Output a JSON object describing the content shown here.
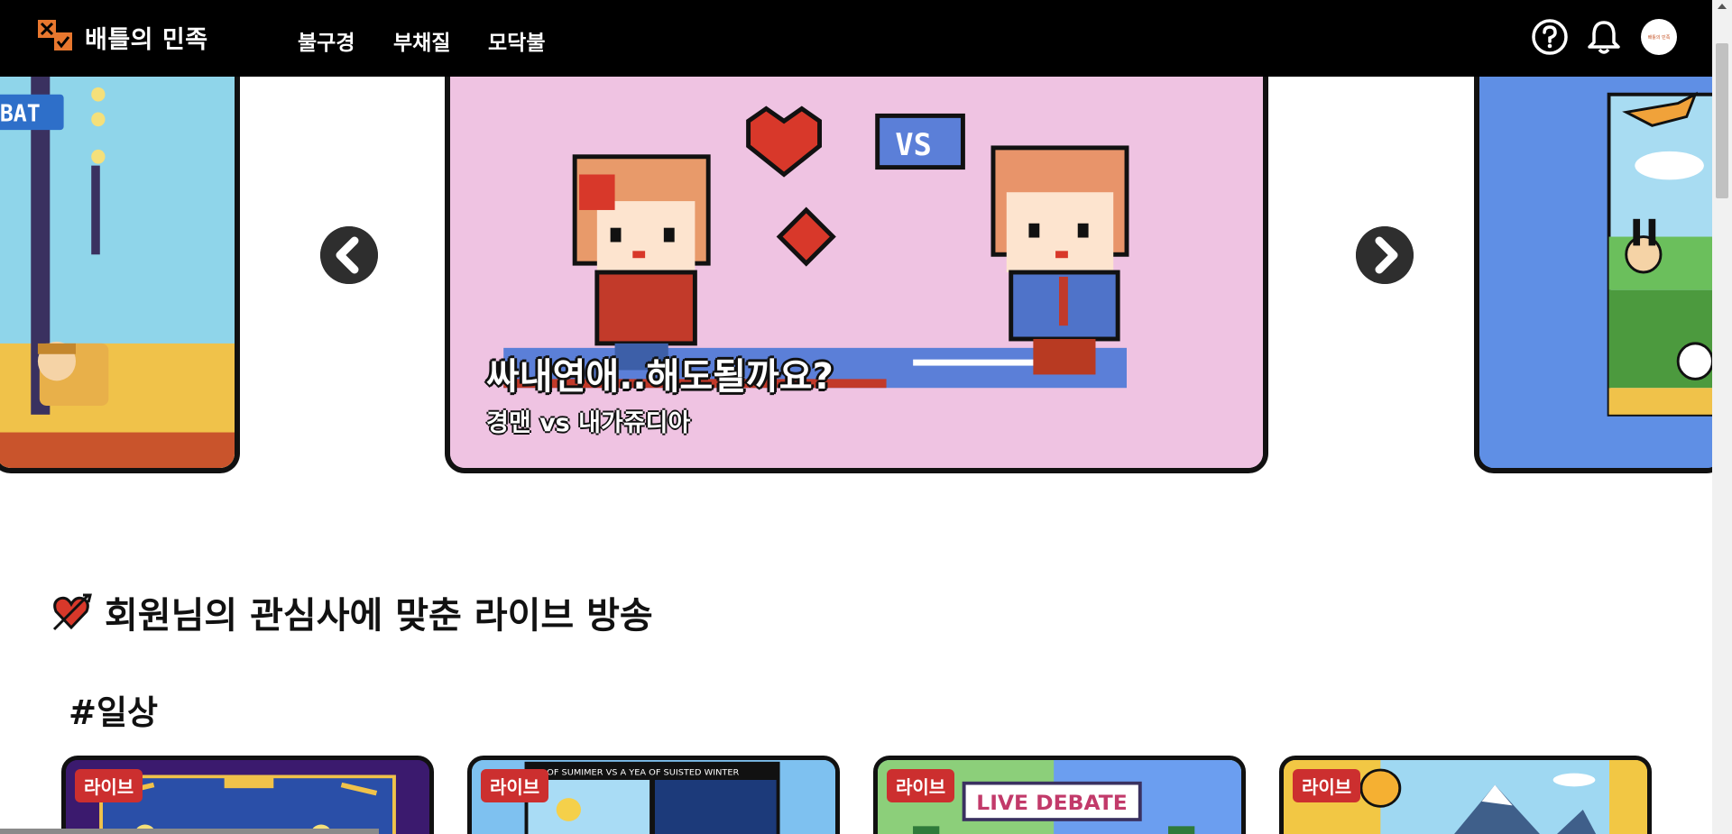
{
  "header": {
    "brand": "배틀의 민족",
    "nav": [
      "불구경",
      "부채질",
      "모닥불"
    ],
    "avatar_text": "배틀의 민족",
    "icons": [
      "help-circle-icon",
      "bell-icon",
      "avatar"
    ]
  },
  "carousel": {
    "slides": [
      {
        "title": "싸내연애..해도될까요?",
        "subtitle": "경맨 vs 내가쥬디아"
      }
    ],
    "art_text": {
      "bat": "BAT",
      "vs": "VS"
    }
  },
  "section": {
    "title": "회원님의 관심사에 맞춘 라이브 방송",
    "tag": "#일상"
  },
  "cards": [
    {
      "badge": "라이브",
      "art_text": ""
    },
    {
      "badge": "라이브",
      "art_text": "EAR OF SUMIMER VS A YEA OF SUISTED WINTER"
    },
    {
      "badge": "라이브",
      "art_text": "LIVE DEBATE"
    },
    {
      "badge": "라이브",
      "art_text": ""
    }
  ],
  "colors": {
    "header_bg": "#000000",
    "banner_main_bg": "#efc3e2",
    "live_badge": "#cc2f2f",
    "accent_orange": "#e8772e"
  }
}
